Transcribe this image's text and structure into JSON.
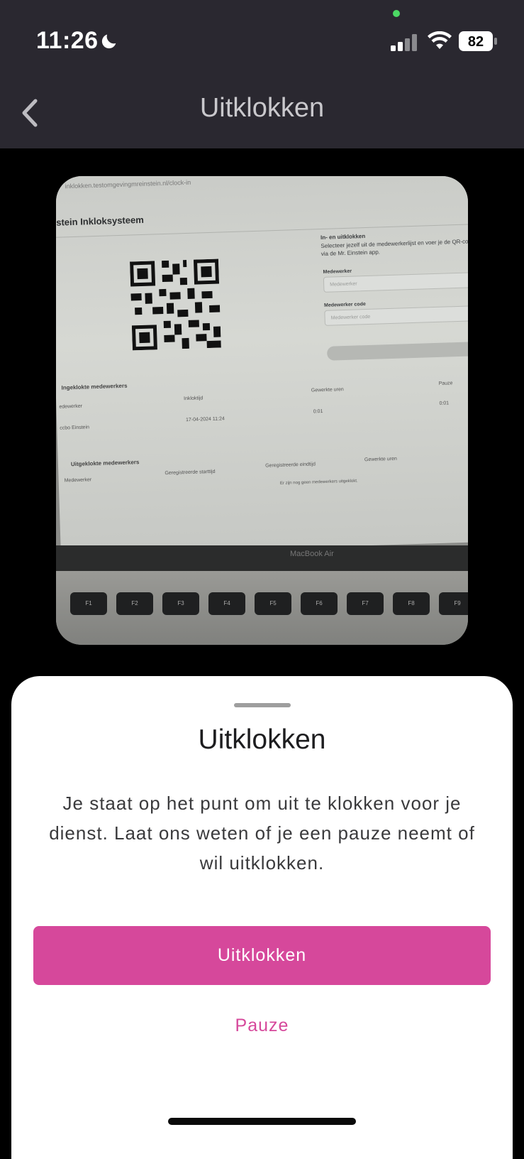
{
  "status_bar": {
    "time": "11:26",
    "battery": "82",
    "icons": [
      "moon-icon",
      "signal-icon",
      "wifi-icon",
      "battery-icon"
    ]
  },
  "nav": {
    "title": "Uitklokken",
    "back_icon": "chevron-left-icon"
  },
  "camera_view": {
    "url": "inklokken.testomgevingmreinstein.nl/clock-in",
    "brand": "stein Inkloksysteem",
    "side_title": "In- en uitklokken",
    "side_text": "Selecteer jezelf uit de medewerkerlijst en voer je de QR-code via de Mr. Einstein app.",
    "label_employee": "Medewerker",
    "placeholder_employee": "Medewerker",
    "label_code": "Medewerker code",
    "placeholder_code": "Medewerker code",
    "section_in": "Ingeklokte medewerkers",
    "col_employee": "edewerker",
    "col_clockin": "Inkloktijd",
    "col_worked": "Gewerkte uren",
    "col_pause": "Pauze",
    "row_name": "ccbo Einstein",
    "row_time": "17-04-2024 11:24",
    "row_worked": "0:01",
    "row_pause": "0:01",
    "section_out": "Uitgeklokte medewerkers",
    "col_out_employee": "Medewerker",
    "col_start": "Geregistreerde starttijd",
    "col_end": "Geregistreerde eindtijd",
    "col_out_worked": "Gewerkte uren",
    "empty_text": "Er zijn nog geen medewerkers uitgeklokt.",
    "laptop_label": "MacBook Air"
  },
  "sheet": {
    "title": "Uitklokken",
    "body": "Je staat op het punt om uit te klokken voor je dienst. Laat ons weten of je een pauze neemt of wil uitklokken.",
    "primary_button": "Uitklokken",
    "secondary_button": "Pauze",
    "accent_color": "#d6489b"
  }
}
